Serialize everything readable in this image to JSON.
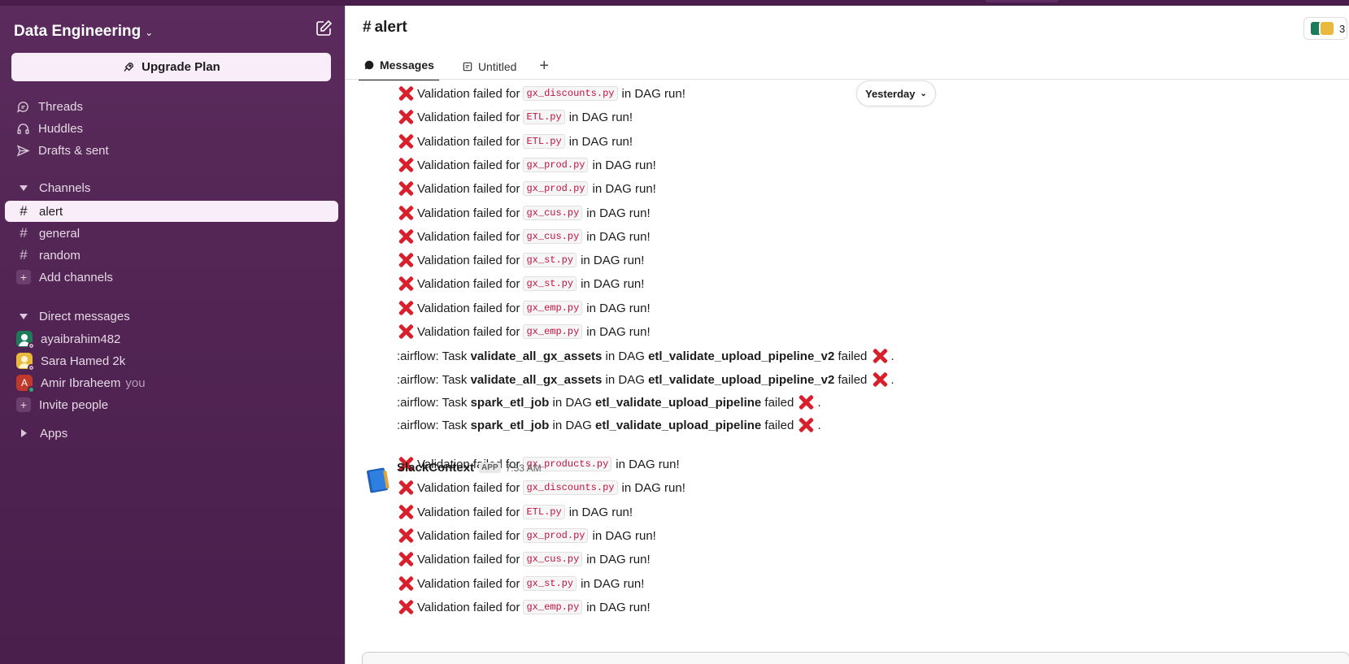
{
  "workspace": {
    "name": "Data Engineering",
    "upgrade_label": "Upgrade Plan"
  },
  "nav": [
    {
      "label": "Threads",
      "icon": "threads-icon"
    },
    {
      "label": "Huddles",
      "icon": "headphones-icon"
    },
    {
      "label": "Drafts & sent",
      "icon": "send-icon"
    }
  ],
  "channels_section": "Channels",
  "channels": [
    "alert",
    "general",
    "random"
  ],
  "add_channels": "Add channels",
  "dm_section": "Direct messages",
  "dms": [
    {
      "name": "ayaibrahim482",
      "color": "#1e7b5a"
    },
    {
      "name": "Sara Hamed 2k",
      "color": "#e8b93c"
    },
    {
      "name": "Amir Ibraheem",
      "you": "you",
      "initial": "A",
      "color": "#c0392b"
    }
  ],
  "invite": "Invite people",
  "apps": "Apps",
  "channel": {
    "hash": "#",
    "name": "alert",
    "member_count": "3"
  },
  "tabs": {
    "messages": "Messages",
    "untitled": "Untitled",
    "add": "+"
  },
  "date_divider": "Yesterday",
  "validation": {
    "prefix": "Validation failed for",
    "suffix": "in DAG run!"
  },
  "airflow": {
    "prefix": ":airflow: Task",
    "in_dag": "in DAG",
    "failed": "failed",
    "period": "."
  },
  "messages_top": [
    "gx_discounts.py",
    "ETL.py",
    "ETL.py",
    "gx_prod.py",
    "gx_prod.py",
    "gx_cus.py",
    "gx_cus.py",
    "gx_st.py",
    "gx_st.py",
    "gx_emp.py",
    "gx_emp.py"
  ],
  "airflow_messages": [
    {
      "task": "validate_all_gx_assets",
      "dag": "etl_validate_upload_pipeline_v2"
    },
    {
      "task": "validate_all_gx_assets",
      "dag": "etl_validate_upload_pipeline_v2"
    },
    {
      "task": "spark_etl_job",
      "dag": "etl_validate_upload_pipeline"
    },
    {
      "task": "spark_etl_job",
      "dag": "etl_validate_upload_pipeline"
    }
  ],
  "sender": {
    "name": "SlackContext",
    "badge": "APP",
    "time": "7:53 AM"
  },
  "messages_bottom": [
    "gx_products.py",
    "gx_discounts.py",
    "ETL.py",
    "gx_prod.py",
    "gx_cus.py",
    "gx_st.py",
    "gx_emp.py"
  ]
}
